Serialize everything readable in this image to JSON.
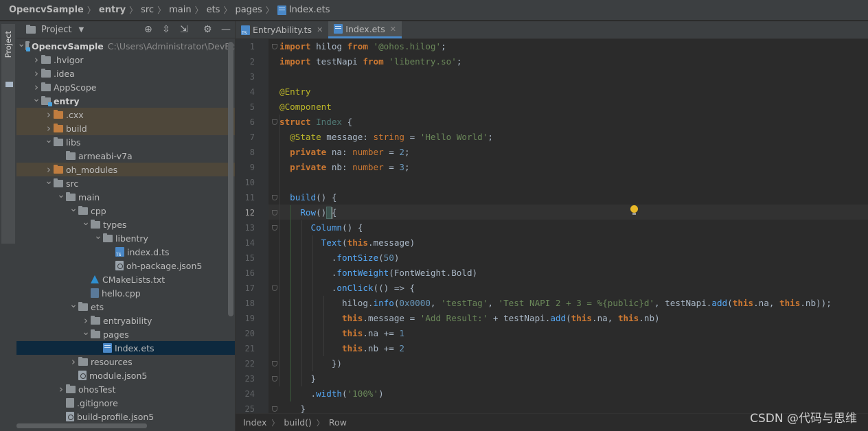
{
  "breadcrumb": {
    "items": [
      "OpencvSample",
      "entry",
      "src",
      "main",
      "ets",
      "pages",
      "Index.ets"
    ]
  },
  "left_stripe": {
    "label": "Project"
  },
  "project_panel": {
    "title": "Project",
    "tree": [
      {
        "label": "OpencvSample",
        "path": "C:\\Users\\Administrator\\DevEc"
      },
      {
        "label": ".hvigor"
      },
      {
        "label": ".idea"
      },
      {
        "label": "AppScope"
      },
      {
        "label": "entry"
      },
      {
        "label": ".cxx"
      },
      {
        "label": "build"
      },
      {
        "label": "libs"
      },
      {
        "label": "armeabi-v7a"
      },
      {
        "label": "oh_modules"
      },
      {
        "label": "src"
      },
      {
        "label": "main"
      },
      {
        "label": "cpp"
      },
      {
        "label": "types"
      },
      {
        "label": "libentry"
      },
      {
        "label": "index.d.ts"
      },
      {
        "label": "oh-package.json5"
      },
      {
        "label": "CMakeLists.txt"
      },
      {
        "label": "hello.cpp"
      },
      {
        "label": "ets"
      },
      {
        "label": "entryability"
      },
      {
        "label": "pages"
      },
      {
        "label": "Index.ets"
      },
      {
        "label": "resources"
      },
      {
        "label": "module.json5"
      },
      {
        "label": "ohosTest"
      },
      {
        "label": ".gitignore"
      },
      {
        "label": "build-profile.json5"
      }
    ]
  },
  "tabs": [
    {
      "label": "EntryAbility.ts"
    },
    {
      "label": "Index.ets"
    }
  ],
  "editor": {
    "line_numbers": [
      "1",
      "2",
      "3",
      "4",
      "5",
      "6",
      "7",
      "8",
      "9",
      "10",
      "11",
      "12",
      "13",
      "14",
      "15",
      "16",
      "17",
      "18",
      "19",
      "20",
      "21",
      "22",
      "23",
      "24",
      "25"
    ],
    "current_line": 12,
    "lines": [
      [
        [
          "kw",
          "import"
        ],
        [
          "p",
          " hilog "
        ],
        [
          "kw",
          "from"
        ],
        [
          "p",
          " "
        ],
        [
          "str",
          "'@ohos.hilog'"
        ],
        [
          "p",
          ";"
        ]
      ],
      [
        [
          "kw",
          "import"
        ],
        [
          "p",
          " testNapi "
        ],
        [
          "kw",
          "from"
        ],
        [
          "p",
          " "
        ],
        [
          "str",
          "'libentry.so'"
        ],
        [
          "p",
          ";"
        ]
      ],
      [],
      [
        [
          "ann",
          "@Entry"
        ]
      ],
      [
        [
          "ann",
          "@Component"
        ]
      ],
      [
        [
          "kw",
          "struct"
        ],
        [
          "p",
          " "
        ],
        [
          "cls",
          "Index"
        ],
        [
          "p",
          " {"
        ]
      ],
      [
        [
          "p",
          "  "
        ],
        [
          "ann",
          "@State"
        ],
        [
          "p",
          " message: "
        ],
        [
          "kw2",
          "string"
        ],
        [
          "p",
          " = "
        ],
        [
          "str",
          "'Hello World'"
        ],
        [
          "p",
          ";"
        ]
      ],
      [
        [
          "p",
          "  "
        ],
        [
          "kw",
          "private"
        ],
        [
          "p",
          " na: "
        ],
        [
          "kw2",
          "number"
        ],
        [
          "p",
          " = "
        ],
        [
          "num",
          "2"
        ],
        [
          "p",
          ";"
        ]
      ],
      [
        [
          "p",
          "  "
        ],
        [
          "kw",
          "private"
        ],
        [
          "p",
          " nb: "
        ],
        [
          "kw2",
          "number"
        ],
        [
          "p",
          " = "
        ],
        [
          "num",
          "3"
        ],
        [
          "p",
          ";"
        ]
      ],
      [],
      [
        [
          "p",
          "  "
        ],
        [
          "fn",
          "build"
        ],
        [
          "p",
          "() {"
        ]
      ],
      [
        [
          "p",
          "    "
        ],
        [
          "fn",
          "Row"
        ],
        [
          "p",
          "() {"
        ]
      ],
      [
        [
          "p",
          "      "
        ],
        [
          "fn",
          "Column"
        ],
        [
          "p",
          "() {"
        ]
      ],
      [
        [
          "p",
          "        "
        ],
        [
          "fn",
          "Text"
        ],
        [
          "p",
          "("
        ],
        [
          "kw",
          "this"
        ],
        [
          "p",
          ".message)"
        ]
      ],
      [
        [
          "p",
          "          ."
        ],
        [
          "fn",
          "fontSize"
        ],
        [
          "p",
          "("
        ],
        [
          "num",
          "50"
        ],
        [
          "p",
          ")"
        ]
      ],
      [
        [
          "p",
          "          ."
        ],
        [
          "fn",
          "fontWeight"
        ],
        [
          "p",
          "(FontWeight.Bold)"
        ]
      ],
      [
        [
          "p",
          "          ."
        ],
        [
          "fn",
          "onClick"
        ],
        [
          "p",
          "(() => {"
        ]
      ],
      [
        [
          "p",
          "            hilog."
        ],
        [
          "fn",
          "info"
        ],
        [
          "p",
          "("
        ],
        [
          "num",
          "0x0000"
        ],
        [
          "p",
          ", "
        ],
        [
          "str",
          "'testTag'"
        ],
        [
          "p",
          ", "
        ],
        [
          "str",
          "'Test NAPI 2 + 3 = %{public}d'"
        ],
        [
          "p",
          ", testNapi."
        ],
        [
          "fn",
          "add"
        ],
        [
          "p",
          "("
        ],
        [
          "kw",
          "this"
        ],
        [
          "p",
          ".na, "
        ],
        [
          "kw",
          "this"
        ],
        [
          "p",
          ".nb));"
        ]
      ],
      [
        [
          "p",
          "            "
        ],
        [
          "kw",
          "this"
        ],
        [
          "p",
          ".message = "
        ],
        [
          "str",
          "'Add Result:'"
        ],
        [
          "p",
          " + testNapi."
        ],
        [
          "fn",
          "add"
        ],
        [
          "p",
          "("
        ],
        [
          "kw",
          "this"
        ],
        [
          "p",
          ".na, "
        ],
        [
          "kw",
          "this"
        ],
        [
          "p",
          ".nb)"
        ]
      ],
      [
        [
          "p",
          "            "
        ],
        [
          "kw",
          "this"
        ],
        [
          "p",
          ".na += "
        ],
        [
          "num",
          "1"
        ]
      ],
      [
        [
          "p",
          "            "
        ],
        [
          "kw",
          "this"
        ],
        [
          "p",
          ".nb += "
        ],
        [
          "num",
          "2"
        ]
      ],
      [
        [
          "p",
          "          })"
        ]
      ],
      [
        [
          "p",
          "      }"
        ]
      ],
      [
        [
          "p",
          "      ."
        ],
        [
          "fn",
          "width"
        ],
        [
          "p",
          "("
        ],
        [
          "str",
          "'100%'"
        ],
        [
          "p",
          ")"
        ]
      ],
      [
        [
          "p",
          "    }"
        ]
      ]
    ]
  },
  "editor_crumbs": [
    "Index",
    "build()",
    "Row"
  ],
  "watermark": "CSDN @代码与思维",
  "colors": {
    "accent": "#4a88c7",
    "highlight_folder": "#4e473a",
    "selection": "#0d293e"
  }
}
